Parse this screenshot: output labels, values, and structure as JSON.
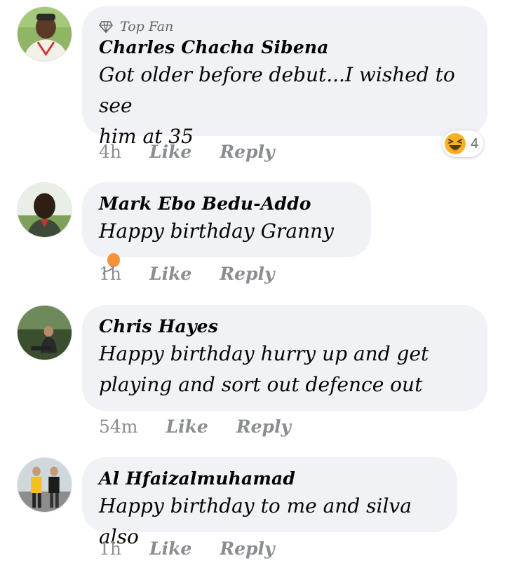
{
  "comments": [
    {
      "badge": "Top Fan",
      "author": "Charles Chacha Sibena",
      "lines": [
        "Got older before debut...I wished to see",
        "him at 35"
      ],
      "time": "4h",
      "like_label": "Like",
      "reply_label": "Reply",
      "reaction": {
        "icon": "laughing-emoji-icon",
        "count": "4"
      }
    },
    {
      "author": "Mark Ebo Bedu-Addo",
      "lines": [
        "Happy birthday Granny"
      ],
      "emoji": "balloon-icon",
      "time": "1h",
      "like_label": "Like",
      "reply_label": "Reply"
    },
    {
      "author": "Chris Hayes",
      "lines": [
        "Happy birthday hurry up and get",
        "playing and sort out defence out"
      ],
      "time": "54m",
      "like_label": "Like",
      "reply_label": "Reply"
    },
    {
      "author": "Al Hfaizalmuhamad",
      "lines": [
        "Happy birthday to me and silva also"
      ],
      "time": "1h",
      "like_label": "Like",
      "reply_label": "Reply"
    }
  ],
  "colors": {
    "bubble": "#f0f2f5",
    "meta_text": "#8a8d91",
    "author_text": "#050505",
    "balloon": "#f7923a",
    "laugh_emoji": "#f7b125"
  }
}
